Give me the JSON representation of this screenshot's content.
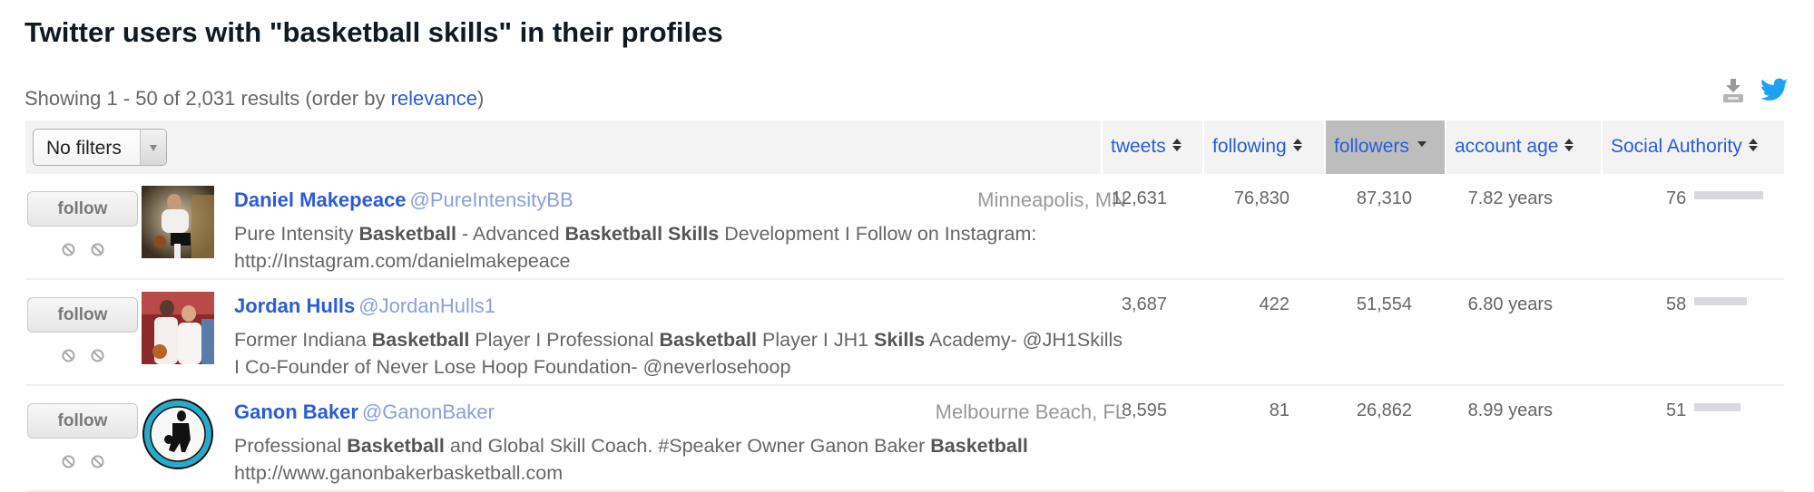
{
  "page": {
    "title": "Twitter users with \"basketball skills\" in their profiles",
    "summary_prefix": "Showing 1 - 50 of 2,031 results (order by ",
    "summary_link": "relevance",
    "summary_suffix": ")"
  },
  "toolbar": {
    "download_icon": "download-icon",
    "twitter_icon": "twitter-bird-icon"
  },
  "filter": {
    "selected": "No filters"
  },
  "columns": [
    {
      "key": "tweets",
      "label": "tweets",
      "sort": "both"
    },
    {
      "key": "following",
      "label": "following",
      "sort": "both"
    },
    {
      "key": "followers",
      "label": "followers",
      "sort": "desc",
      "active": true
    },
    {
      "key": "account_age",
      "label": "account age",
      "sort": "both"
    },
    {
      "key": "social_authority",
      "label": "Social Authority",
      "sort": "both"
    }
  ],
  "colors": {
    "link": "#2b5bd6",
    "active_header": "#bdbdbd",
    "header_bg": "#f3f3f3",
    "sa_bar": "#d8d8de"
  },
  "rows": [
    {
      "follow_label": "follow",
      "name": "Daniel Makepeace",
      "handle": "@PureIntensityBB",
      "location": "Minneapolis, MN",
      "bio": [
        {
          "t": "Pure Intensity "
        },
        {
          "t": "Basketball",
          "b": true
        },
        {
          "t": " - Advanced "
        },
        {
          "t": "Basketball Skills",
          "b": true
        },
        {
          "t": " Development I Follow on Instagram: http://Instagram.com/danielmakepeace"
        }
      ],
      "tweets": "12,631",
      "following": "76,830",
      "followers": "87,310",
      "account_age": "7.82 years",
      "social_authority": "76",
      "social_authority_value": 76,
      "avatar": "avatar-photo-player-dribbling"
    },
    {
      "follow_label": "follow",
      "name": "Jordan Hulls",
      "handle": "@JordanHulls1",
      "location": "",
      "bio": [
        {
          "t": "Former Indiana "
        },
        {
          "t": "Basketball",
          "b": true
        },
        {
          "t": " Player I Professional "
        },
        {
          "t": "Basketball",
          "b": true
        },
        {
          "t": " Player I JH1 "
        },
        {
          "t": "Skills",
          "b": true
        },
        {
          "t": " Academy- @JH1Skills I Co-Founder of Never Lose Hoop Foundation- @neverlosehoop"
        }
      ],
      "tweets": "3,687",
      "following": "422",
      "followers": "51,554",
      "account_age": "6.80 years",
      "social_authority": "58",
      "social_authority_value": 58,
      "avatar": "avatar-photo-players-celebrating"
    },
    {
      "follow_label": "follow",
      "name": "Ganon Baker",
      "handle": "@GanonBaker",
      "location": "Melbourne Beach, FL",
      "bio": [
        {
          "t": "Professional "
        },
        {
          "t": "Basketball",
          "b": true
        },
        {
          "t": " and Global Skill Coach. #Speaker Owner Ganon Baker "
        },
        {
          "t": "Basketball",
          "b": true
        },
        {
          "t": " http://www.ganonbakerbasketball.com"
        }
      ],
      "tweets": "8,595",
      "following": "81",
      "followers": "26,862",
      "account_age": "8.99 years",
      "social_authority": "51",
      "social_authority_value": 51,
      "avatar": "avatar-logo-circle"
    }
  ]
}
